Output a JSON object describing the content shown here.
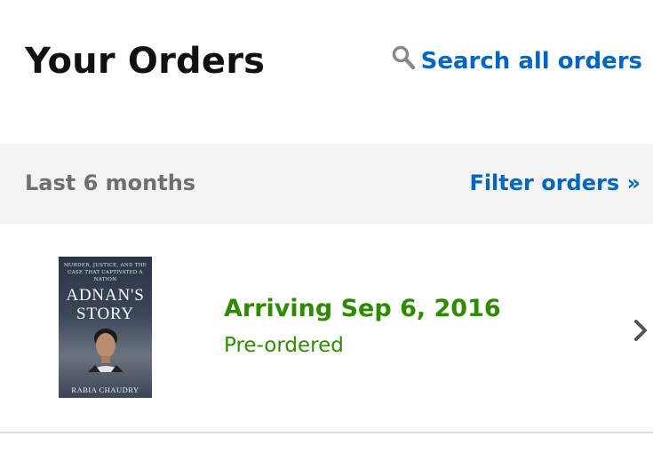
{
  "header": {
    "title": "Your Orders",
    "search_label": "Search all orders",
    "search_icon": "search-icon"
  },
  "filter_bar": {
    "range_label": "Last 6 months",
    "filter_link": "Filter orders »"
  },
  "orders": [
    {
      "status": "Arriving Sep 6, 2016",
      "substatus": "Pre-ordered",
      "book": {
        "tagline": "MURDER, JUSTICE, AND THE CASE THAT CAPTIVATED A NATION",
        "title_line1": "ADNAN'S",
        "title_line2": "STORY",
        "author": "RABIA CHAUDRY"
      },
      "icon": "chevron-right-icon"
    }
  ],
  "colors": {
    "link_blue": "#0066c0",
    "status_green": "#2e8b00",
    "filter_bar_bg": "#f3f3f3",
    "muted_text": "#6f6f6f"
  }
}
